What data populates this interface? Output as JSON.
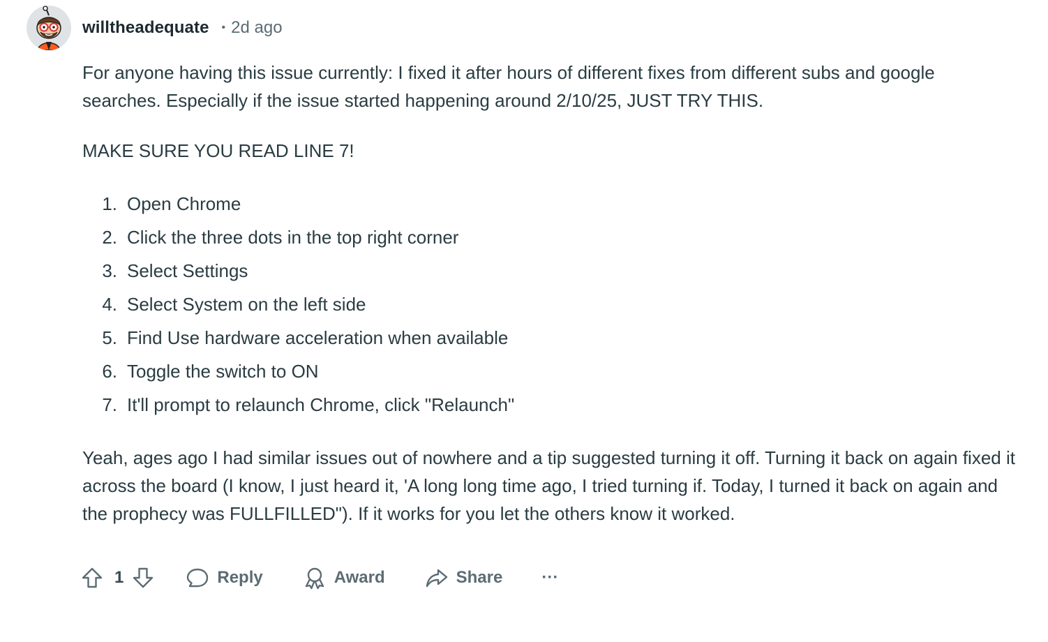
{
  "comment": {
    "author": "willtheadequate",
    "separator": "•",
    "timestamp": "2d ago",
    "intro": "For anyone having this issue currently: I fixed it after hours of different fixes from different subs and google searches. Especially if the issue started happening around 2/10/25, JUST TRY THIS.",
    "emphasis": "MAKE SURE YOU READ LINE 7!",
    "steps": [
      {
        "num": "1.",
        "text": "Open Chrome"
      },
      {
        "num": "2.",
        "text": "Click the three dots in the top right corner"
      },
      {
        "num": "3.",
        "text": "Select Settings"
      },
      {
        "num": "4.",
        "text": "Select System on the left side"
      },
      {
        "num": "5.",
        "text": "Find Use hardware acceleration when available"
      },
      {
        "num": "6.",
        "text": "Toggle the switch to ON"
      },
      {
        "num": "7.",
        "text": "It'll prompt to relaunch Chrome, click \"Relaunch\""
      }
    ],
    "closing": "Yeah, ages ago I had similar issues out of nowhere and a tip suggested turning it off. Turning it back on again fixed it across the board (I know, I just heard it, 'A long long time ago, I tried turning if. Today, I turned it back on again and the prophecy was FULLFILLED\"). If it works for you let the others know it worked."
  },
  "actions": {
    "vote_count": "1",
    "reply_label": "Reply",
    "award_label": "Award",
    "share_label": "Share",
    "more_label": "···"
  },
  "icons": {
    "upvote": "upvote-arrow-icon",
    "downvote": "downvote-arrow-icon",
    "reply": "speech-bubble-icon",
    "award": "award-ribbon-icon",
    "share": "share-arrow-icon",
    "more": "ellipsis-icon"
  },
  "colors": {
    "text": "#2a3c42",
    "muted": "#5c6c74",
    "username": "#1c2a30"
  }
}
